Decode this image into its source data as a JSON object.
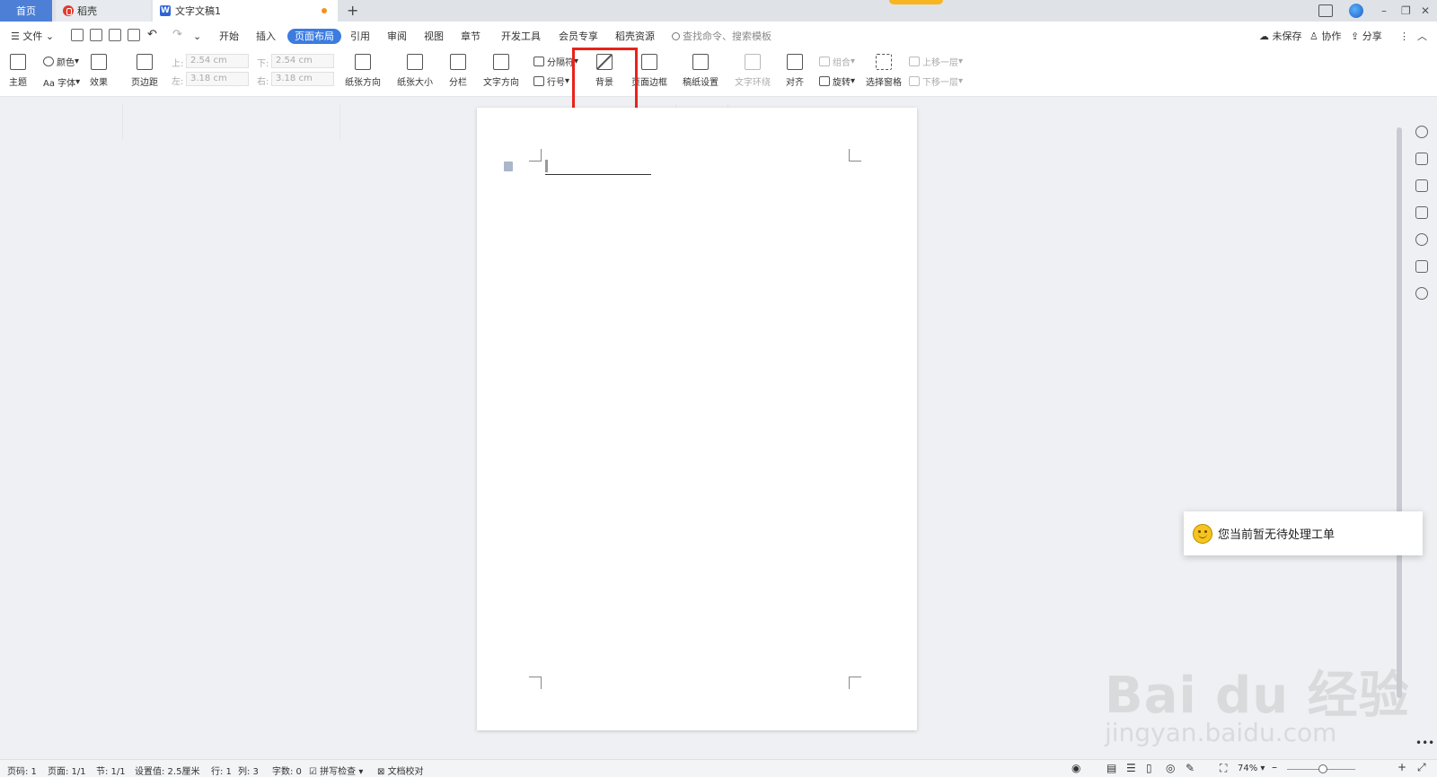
{
  "tabs": {
    "home": "首页",
    "daoke": "稻壳",
    "doc": "文字文稿1",
    "new_tab": "+"
  },
  "window": {
    "minimize": "–",
    "restore": "❐",
    "close": "✕"
  },
  "menu": {
    "file": "文件",
    "items": [
      "开始",
      "插入",
      "页面布局",
      "引用",
      "审阅",
      "视图",
      "章节",
      "开发工具",
      "会员专享",
      "稻壳资源"
    ],
    "active": "页面布局",
    "search_placeholder": "查找命令、搜索模板",
    "unsaved": "未保存",
    "collab": "协作",
    "share": "分享"
  },
  "ribbon": {
    "theme": "主题",
    "color": "颜色",
    "font": "Aa 字体",
    "effect": "效果",
    "margin": "页边距",
    "top_lbl": "上:",
    "top_val": "2.54 cm",
    "bottom_lbl": "下:",
    "bottom_val": "2.54 cm",
    "left_lbl": "左:",
    "left_val": "3.18 cm",
    "right_lbl": "右:",
    "right_val": "3.18 cm",
    "orientation": "纸张方向",
    "size": "纸张大小",
    "columns": "分栏",
    "text_dir": "文字方向",
    "separator": "分隔符",
    "line_num": "行号",
    "background": "背景",
    "border": "页面边框",
    "manuscript": "稿纸设置",
    "wrap": "文字环绕",
    "align": "对齐",
    "group": "组合",
    "rotate": "旋转",
    "select_pane": "选择窗格",
    "bring_up": "上移一层",
    "send_down": "下移一层"
  },
  "toast": {
    "text": "您当前暂无待处理工单"
  },
  "watermark": {
    "brand": "Bai du 经验",
    "url": "jingyan.baidu.com"
  },
  "status": {
    "page_num": "页码: 1",
    "pages": "页面: 1/1",
    "section": "节: 1/1",
    "setting": "设置值: 2.5厘米",
    "row": "行: 1",
    "col": "列: 3",
    "words": "字数: 0",
    "spell": "拼写检查",
    "proof": "文档校对",
    "zoom": "74%",
    "zoom_minus": "–",
    "zoom_plus": "+"
  },
  "colors": {
    "accent": "#3c7ce0",
    "highlight": "#e8231a",
    "home_tab": "#4d7fd6"
  }
}
